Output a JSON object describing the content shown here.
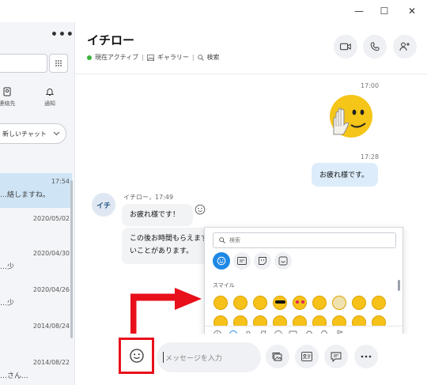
{
  "window": {
    "controls": {
      "minimize": "—",
      "maximize": "☐",
      "close": "✕"
    }
  },
  "sidebar": {
    "more": "•••",
    "nav": [
      {
        "label": "連絡先",
        "icon": "contacts-icon"
      },
      {
        "label": "通知",
        "icon": "bell-icon"
      }
    ],
    "new_chat": "新しいチャット",
    "conversations": [
      {
        "snippet": "…絡しますね。",
        "date": "17:54",
        "selected": true
      },
      {
        "snippet": "",
        "date": "2020/05/02"
      },
      {
        "snippet": "…少",
        "date": "2020/04/30"
      },
      {
        "snippet": "…少",
        "date": "2020/04/26"
      },
      {
        "snippet": "",
        "date": "2014/08/24"
      },
      {
        "snippet": "…さん...",
        "date": "2014/08/22"
      }
    ]
  },
  "header": {
    "name": "イチロー",
    "status": "現在アクティブ",
    "gallery": "ギャラリー",
    "search": "検索"
  },
  "messages": {
    "time_1": "17:00",
    "time_2": "17:28",
    "my_message": "お疲れ様です。",
    "avatar_initials": "イチ",
    "sender_meta": "イチロー，17:49",
    "their_message_1": "お疲れ様です！",
    "their_message_2_line1": "この後お時間もらえます",
    "their_message_2_line2": "いことがあります。"
  },
  "emoji_panel": {
    "search_placeholder": "検索",
    "category_label": "スマイル",
    "emoji_color": "#f6c21a"
  },
  "composer": {
    "placeholder": "メッセージを入力"
  },
  "annotation": {
    "highlight_color": "#e8101a"
  }
}
